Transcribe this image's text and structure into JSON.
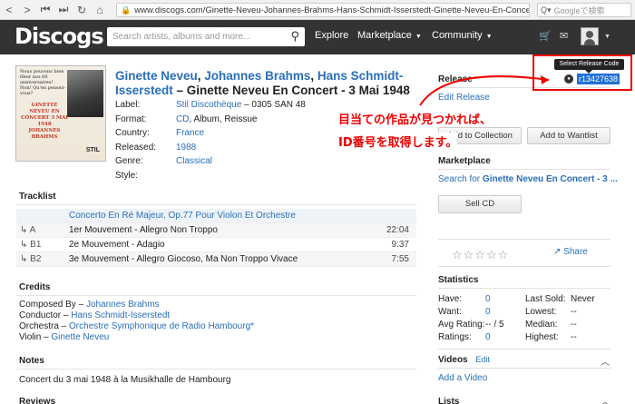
{
  "browser": {
    "url": "www.discogs.com/Ginette-Neveu-Johannes-Brahms-Hans-Schmidt-Isserstedt-Ginette-Neveu-En-Concert-3-...",
    "search_placeholder": "Googleで検索"
  },
  "header": {
    "logo": "Discogs",
    "search_placeholder": "Search artists, albums and more...",
    "nav": [
      "Explore",
      "Marketplace",
      "Community"
    ]
  },
  "release": {
    "artist1": "Ginette Neveu",
    "artist2": "Johannes Brahms",
    "artist3": "Hans Schmidt-Isserstedt",
    "sep1": ", ",
    "sep2": ", ",
    "title_suffix": " – Ginette Neveu En Concert - 3 Mai 1948",
    "cover": {
      "top_text": "Nous pouvons bien fêter nos 60 anniversaires! Non! Qu'en pensez-vous?",
      "mid_text": "GINETTE NEVEU EN CONCERT 3 MAI 1948 JOHANNES BRAHMS",
      "label_mark": "STIL"
    },
    "meta": [
      {
        "k": "Label:",
        "v": "Stil Discothèque",
        "v2": " – 0305 SAN 48",
        "link": true
      },
      {
        "k": "Format:",
        "v": "CD",
        "v2": ", Album, Reissue",
        "link": true
      },
      {
        "k": "Country:",
        "v": "France",
        "v2": "",
        "link": true
      },
      {
        "k": "Released:",
        "v": "1988",
        "v2": "",
        "link": true
      },
      {
        "k": "Genre:",
        "v": "Classical",
        "v2": "",
        "link": true
      },
      {
        "k": "Style:",
        "v": "",
        "v2": "",
        "link": false
      }
    ]
  },
  "tracklist": {
    "title": "Tracklist",
    "heading": "Concerto En Ré Majeur, Op.77 Pour Violon Et Orchestre",
    "tracks": [
      {
        "pos": "↳ A",
        "title": "1er Mouvement - Allegro Non Troppo",
        "dur": "22:04"
      },
      {
        "pos": "↳ B1",
        "title": "2e Mouvement - Adagio",
        "dur": "9:37"
      },
      {
        "pos": "↳ B2",
        "title": "3e Mouvement - Allegro Giocoso, Ma Non Troppo Vivace",
        "dur": "7:55"
      }
    ]
  },
  "credits": {
    "title": "Credits",
    "items": [
      {
        "role": "Composed By – ",
        "name": "Johannes Brahms"
      },
      {
        "role": "Conductor – ",
        "name": "Hans Schmidt-Isserstedt"
      },
      {
        "role": "Orchestra – ",
        "name": "Orchestre Symphonique de Radio Hambourg*"
      },
      {
        "role": "Violin – ",
        "name": "Ginette Neveu"
      }
    ]
  },
  "notes": {
    "title": "Notes",
    "text": "Concert du 3 mai 1948 à la Musikhalle de Hambourg"
  },
  "reviews": {
    "title": "Reviews"
  },
  "sidebar": {
    "release_title": "Release",
    "edit_release": "Edit Release",
    "add_collection": "Add to Collection",
    "add_wantlist": "Add to Wantlist",
    "marketplace_title": "Marketplace",
    "search_for": "Search for ",
    "search_item": "Ginette Neveu En Concert - 3 ...",
    "sell_cd": "Sell CD",
    "stars": "☆☆☆☆☆",
    "share": "Share",
    "statistics_title": "Statistics",
    "stats": {
      "have_label": "Have:",
      "have": "0",
      "want_label": "Want:",
      "want": "0",
      "avg_label": "Avg Rating:",
      "avg": "-- / 5",
      "ratings_label": "Ratings:",
      "ratings": "0",
      "last_sold_label": "Last Sold:",
      "last_sold": "Never",
      "lowest_label": "Lowest:",
      "lowest": "--",
      "median_label": "Median:",
      "median": "--",
      "highest_label": "Highest:",
      "highest": "--"
    },
    "videos_title": "Videos",
    "videos_edit": "Edit",
    "add_video": "Add a Video",
    "lists_title": "Lists"
  },
  "overlay": {
    "tooltip": "Select Release Code",
    "release_code": "r13427638",
    "annotation_line1": "目当ての作品が見つかれば、",
    "annotation_line2": "ID番号を取得します。",
    "accent_color": "#e00000"
  }
}
